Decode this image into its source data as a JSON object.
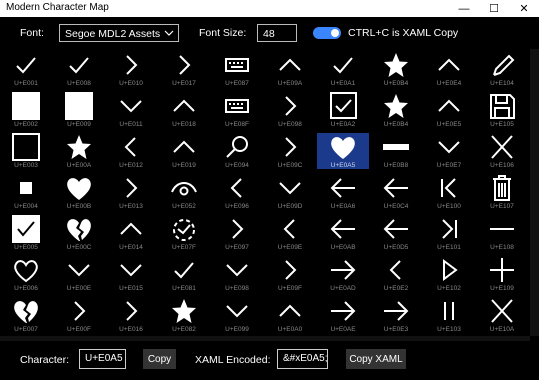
{
  "window": {
    "title": "Modern Character Map",
    "minimize": "—",
    "maximize": "☐",
    "close": "✕"
  },
  "toolbar": {
    "font_label": "Font:",
    "font_value": "Segoe MDL2 Assets",
    "size_label": "Font Size:",
    "size_value": "48",
    "toggle_label": "CTRL+C is XAML Copy",
    "toggle_on": true
  },
  "grid": {
    "selected": "U+E0A5",
    "cells": [
      [
        "check",
        "U+E001"
      ],
      [
        "check",
        "U+E008"
      ],
      [
        "chev-r",
        "U+E010"
      ],
      [
        "chev-r",
        "U+E017"
      ],
      [
        "keyboard",
        "U+E087"
      ],
      [
        "chev-u",
        "U+E09A"
      ],
      [
        "check",
        "U+E0A1"
      ],
      [
        "star",
        "U+E0B4"
      ],
      [
        "chev-u",
        "U+E0E4"
      ],
      [
        "pencil",
        "U+E104"
      ],
      [
        "fill-square",
        "U+E002"
      ],
      [
        "fill-square",
        "U+E009"
      ],
      [
        "chev-d",
        "U+E011"
      ],
      [
        "chev-u",
        "U+E018"
      ],
      [
        "keyboard",
        "U+E08F"
      ],
      [
        "chev-r",
        "U+E098"
      ],
      [
        "check-box",
        "U+E0A2"
      ],
      [
        "star",
        "U+E0B4"
      ],
      [
        "chev-u",
        "U+E0E5"
      ],
      [
        "save",
        "U+E105"
      ],
      [
        "square",
        "U+E003"
      ],
      [
        "star",
        "U+E00A"
      ],
      [
        "chev-l",
        "U+E012"
      ],
      [
        "chev-u",
        "U+E019"
      ],
      [
        "search",
        "U+E094"
      ],
      [
        "chev-r",
        "U+E09C"
      ],
      [
        "heart",
        "U+E0A5"
      ],
      [
        "bar",
        "U+E0B8"
      ],
      [
        "chev-d",
        "U+E0E7"
      ],
      [
        "x",
        "U+E106"
      ],
      [
        "small-square",
        "U+E004"
      ],
      [
        "heart",
        "U+E00B"
      ],
      [
        "chev-r",
        "U+E013"
      ],
      [
        "eye",
        "U+E052"
      ],
      [
        "chev-l",
        "U+E096"
      ],
      [
        "chev-d",
        "U+E09D"
      ],
      [
        "arrow-l",
        "U+E0A6"
      ],
      [
        "arrow-l",
        "U+E0C4"
      ],
      [
        "skip-first",
        "U+E100"
      ],
      [
        "trash",
        "U+E107"
      ],
      [
        "check-filled",
        "U+E005"
      ],
      [
        "broken-heart",
        "U+E00C"
      ],
      [
        "chev-u",
        "U+E014"
      ],
      [
        "sync-dash",
        "U+E07F"
      ],
      [
        "chev-r",
        "U+E097"
      ],
      [
        "chev-l",
        "U+E09E"
      ],
      [
        "arrow-l",
        "U+E0AB"
      ],
      [
        "arrow-l",
        "U+E0D5"
      ],
      [
        "skip-last",
        "U+E101"
      ],
      [
        "minus",
        "U+E108"
      ],
      [
        "heart-outline",
        "U+E006"
      ],
      [
        "chev-d",
        "U+E00E"
      ],
      [
        "chev-d",
        "U+E015"
      ],
      [
        "check",
        "U+E081"
      ],
      [
        "chev-d",
        "U+E098"
      ],
      [
        "chev-r",
        "U+E09F"
      ],
      [
        "arrow-r",
        "U+E0AD"
      ],
      [
        "chev-l",
        "U+E0E2"
      ],
      [
        "play",
        "U+E102"
      ],
      [
        "plus",
        "U+E109"
      ],
      [
        "broken-heart",
        "U+E007"
      ],
      [
        "chev-r",
        "U+E00F"
      ],
      [
        "chev-r",
        "U+E016"
      ],
      [
        "star",
        "U+E082"
      ],
      [
        "chev-d",
        "U+E099"
      ],
      [
        "chev-u",
        "U+E0A0"
      ],
      [
        "arrow-r",
        "U+E0AE"
      ],
      [
        "arrow-r",
        "U+E0E3"
      ],
      [
        "pause",
        "U+E103"
      ],
      [
        "x",
        "U+E10A"
      ]
    ]
  },
  "bottom": {
    "char_label": "Character:",
    "char_value": "U+E0A5",
    "copy_label": "Copy",
    "xaml_label": "XAML Encoded:",
    "xaml_value": "&#xE0A5;",
    "copy_xaml_label": "Copy XAML"
  }
}
